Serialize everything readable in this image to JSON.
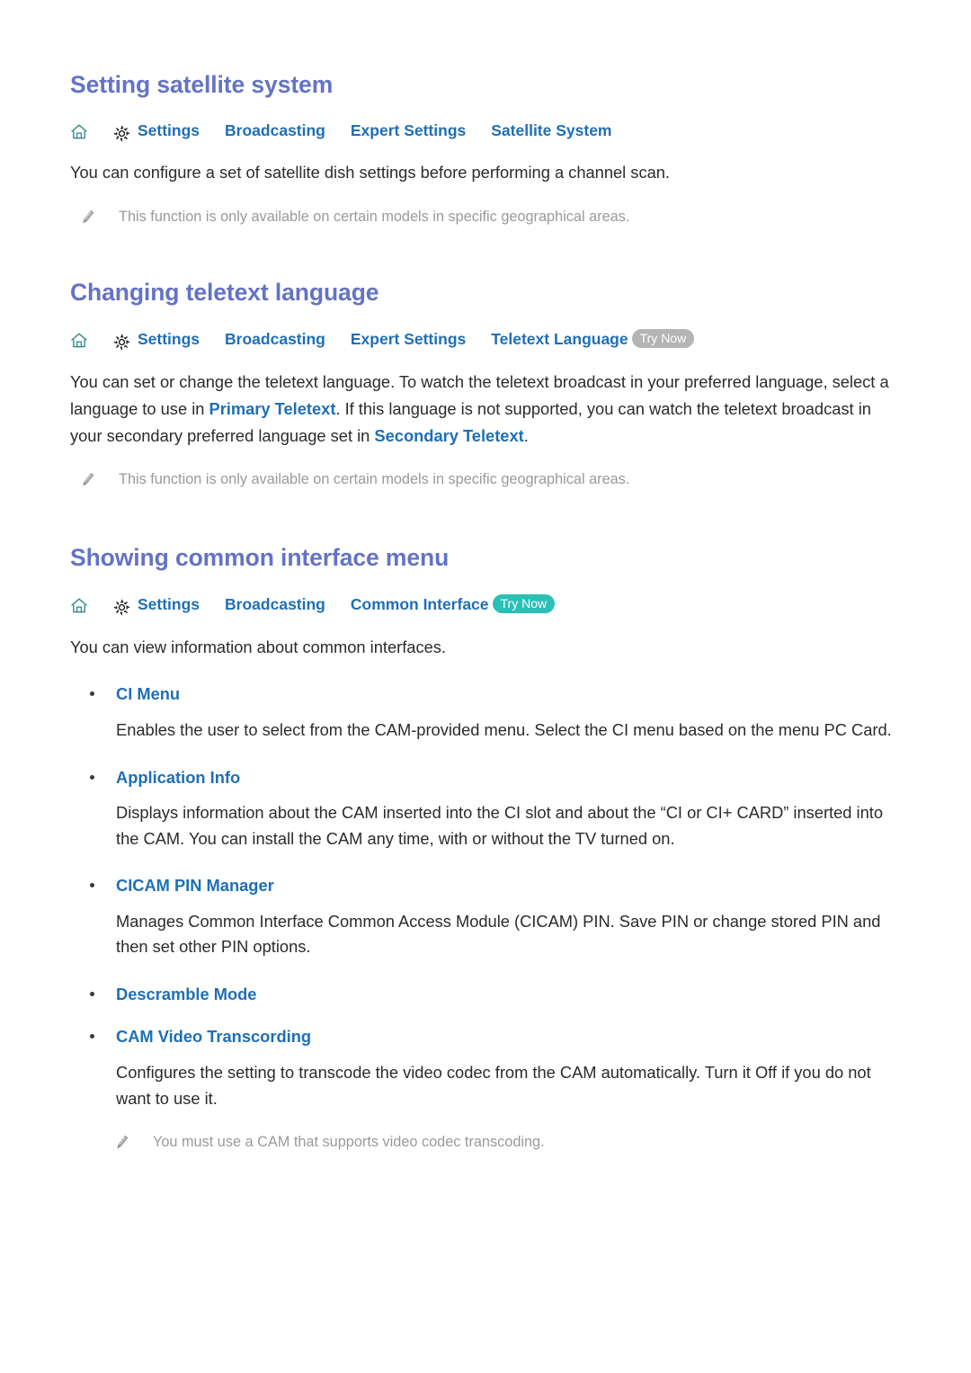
{
  "sections": [
    {
      "id": "satellite",
      "title": "Setting satellite system",
      "breadcrumb": {
        "home_icon": "home-icon",
        "gear_icon": "gear-icon",
        "items": [
          "Settings",
          "Broadcasting",
          "Expert Settings",
          "Satellite System"
        ],
        "try_now": null
      },
      "body": "You can configure a set of satellite dish settings before performing a channel scan.",
      "note": "This function is only available on certain models in specific geographical areas."
    },
    {
      "id": "teletext",
      "title": "Changing teletext language",
      "breadcrumb": {
        "home_icon": "home-icon",
        "gear_icon": "gear-icon",
        "items": [
          "Settings",
          "Broadcasting",
          "Expert Settings",
          "Teletext Language"
        ],
        "try_now": "Try Now",
        "try_now_color": "#b4b4b4"
      },
      "body_parts": {
        "p1": "You can set or change the teletext language. To watch the teletext broadcast in your preferred language, select a language to use in ",
        "link1": "Primary Teletext",
        "p2": ". If this language is not supported, you can watch the teletext broadcast in your secondary preferred language set in ",
        "link2": "Secondary Teletext",
        "p3": "."
      },
      "note": "This function is only available on certain models in specific geographical areas."
    },
    {
      "id": "common-interface",
      "title": "Showing common interface menu",
      "breadcrumb": {
        "home_icon": "home-icon",
        "gear_icon": "gear-icon",
        "items": [
          "Settings",
          "Broadcasting",
          "Common Interface"
        ],
        "try_now": "Try Now",
        "try_now_color": "#2bbfb6"
      },
      "body": "You can view information about common interfaces.",
      "bullets": [
        {
          "label": "CI Menu",
          "desc": "Enables the user to select from the CAM-provided menu. Select the CI menu based on the menu PC Card."
        },
        {
          "label": "Application Info",
          "desc": "Displays information about the CAM inserted into the CI slot and about the “CI or CI+ CARD” inserted into the CAM. You can install the CAM any time, with or without the TV turned on."
        },
        {
          "label": "CICAM PIN Manager",
          "desc": "Manages Common Interface Common Access Module (CICAM) PIN. Save PIN or change stored PIN and then set other PIN options."
        },
        {
          "label": "Descramble Mode",
          "desc": null
        },
        {
          "label": "CAM Video Transcording",
          "desc": "Configures the setting to transcode the video codec from the CAM automatically. Turn it Off if you do not want to use it."
        }
      ],
      "note": "You must use a CAM that supports video codec transcoding."
    }
  ],
  "colors": {
    "heading": "#6473c4",
    "link": "#1f6fb5",
    "body": "#2b2b2b",
    "note": "#9a9a9a",
    "trynow_gray": "#b4b4b4",
    "trynow_teal": "#2bbfb6",
    "home_icon": "#2e8b86"
  }
}
